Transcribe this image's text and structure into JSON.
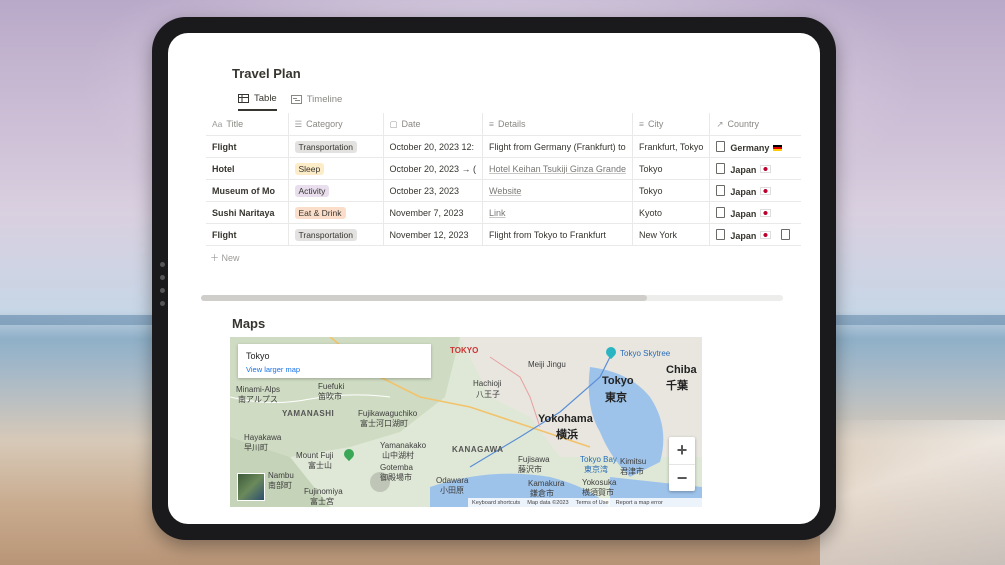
{
  "page": {
    "title": "Travel Plan",
    "views": [
      {
        "label": "Table",
        "icon": "table-icon",
        "active": true
      },
      {
        "label": "Timeline",
        "icon": "timeline-icon",
        "active": false
      }
    ],
    "new_label": "New",
    "maps_title": "Maps"
  },
  "table": {
    "columns": [
      {
        "label": "Title",
        "icon": "Aa"
      },
      {
        "label": "Category",
        "icon": "☰"
      },
      {
        "label": "Date",
        "icon": "▢"
      },
      {
        "label": "Details",
        "icon": "≡"
      },
      {
        "label": "City",
        "icon": "≡"
      },
      {
        "label": "Country",
        "icon": "↗"
      }
    ],
    "rows": [
      {
        "title": "Flight",
        "category": "Transportation",
        "category_color": "#e3e2e0",
        "date": "October 20, 2023 12:",
        "details": "Flight from Germany (Frankfurt) to",
        "details_link": false,
        "city": "Frankfurt, Tokyo",
        "country": "Germany",
        "flag": "de"
      },
      {
        "title": "Hotel",
        "category": "Sleep",
        "category_color": "#fdecc8",
        "date": "October 20, 2023 → (",
        "details": "Hotel Keihan Tsukiji Ginza Grande",
        "details_link": true,
        "city": "Tokyo",
        "country": "Japan",
        "flag": "jp"
      },
      {
        "title": "Museum of Mo",
        "category": "Activity",
        "category_color": "#e8deee",
        "date": "October 23, 2023",
        "details": "Website",
        "details_link": true,
        "city": "Tokyo",
        "country": "Japan",
        "flag": "jp"
      },
      {
        "title": "Sushi Naritaya",
        "category": "Eat & Drink",
        "category_color": "#fadec9",
        "date": "November 7, 2023",
        "details": "Link",
        "details_link": true,
        "city": "Kyoto",
        "country": "Japan",
        "flag": "jp"
      },
      {
        "title": "Flight",
        "category": "Transportation",
        "category_color": "#e3e2e0",
        "date": "November 12, 2023",
        "details": "Flight from Tokyo to Frankfurt",
        "details_link": false,
        "city": "New York",
        "country": "Japan",
        "flag": "jp"
      }
    ]
  },
  "map": {
    "card_title": "Tokyo",
    "card_link": "View larger map",
    "labels": {
      "tokyo_top": "TOKYO",
      "meiji": "Meiji Jingu",
      "skytree": "Tokyo Skytree",
      "chiba": "Chiba",
      "chiba_jp": "千葉",
      "tokyo": "Tokyo",
      "tokyo_jp": "東京",
      "hachioji": "Hachioji",
      "hachioji_jp": "八王子",
      "yamanashi": "YAMANASHI",
      "fuefuki": "Fuefuki",
      "fuefuki_jp": "笛吹市",
      "minami": "Minami-Alps",
      "minami_jp": "南アルプス",
      "fujikawa": "Fujikawaguchiko",
      "fujikawa_jp": "富士河口湖町",
      "yokohama": "Yokohama",
      "yokohama_jp": "横浜",
      "kanagawa": "KANAGAWA",
      "hayakawa": "Hayakawa",
      "hayakawa_jp": "早川町",
      "mtfuji": "Mount Fuji",
      "mtfuji_jp": "富士山",
      "yamanakako": "Yamanakako",
      "yamanakako_jp": "山中湖村",
      "gotemba": "Gotemba",
      "gotemba_jp": "御殿場市",
      "fujisawa": "Fujisawa",
      "fujisawa_jp": "藤沢市",
      "tokyobay": "Tokyo Bay",
      "tokyobay_jp": "東京湾",
      "kimitsu": "Kimitsu",
      "kimitsu_jp": "君津市",
      "odawara": "Odawara",
      "odawara_jp": "小田原",
      "kamakura": "Kamakura",
      "kamakura_jp": "鎌倉市",
      "yokosuka": "Yokosuka",
      "yokosuka_jp": "横須賀市",
      "fujinomiya": "Fujinomiya",
      "fujinomiya_jp": "富士宮",
      "nambu": "Nambu",
      "nambu_jp": "南部町"
    },
    "zoom_in": "+",
    "zoom_out": "−",
    "footer": [
      "Keyboard shortcuts",
      "Map data ©2023",
      "Terms of Use",
      "Report a map error"
    ]
  }
}
